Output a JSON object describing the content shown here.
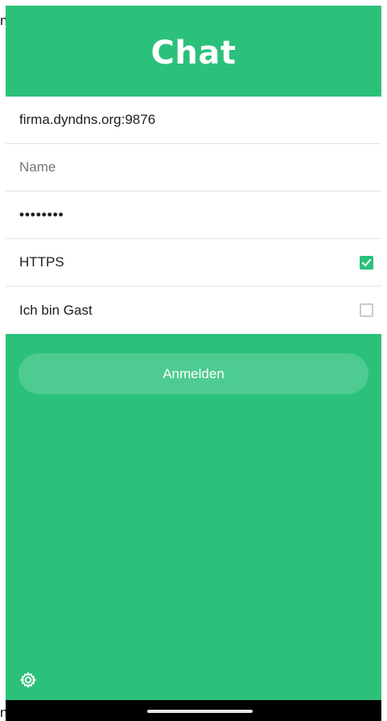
{
  "header": {
    "title": "Chat"
  },
  "form": {
    "server": "firma.dyndns.org:9876",
    "name_placeholder": "Name",
    "password_mask": "••••••••",
    "https_label": "HTTPS",
    "https_checked": true,
    "guest_label": "Ich bin Gast",
    "guest_checked": false
  },
  "actions": {
    "login_label": "Anmelden",
    "settings_icon": "gear-icon"
  },
  "edge_glyphs": {
    "top": "n",
    "bottom": "n"
  },
  "colors": {
    "accent": "#2bc17b"
  }
}
